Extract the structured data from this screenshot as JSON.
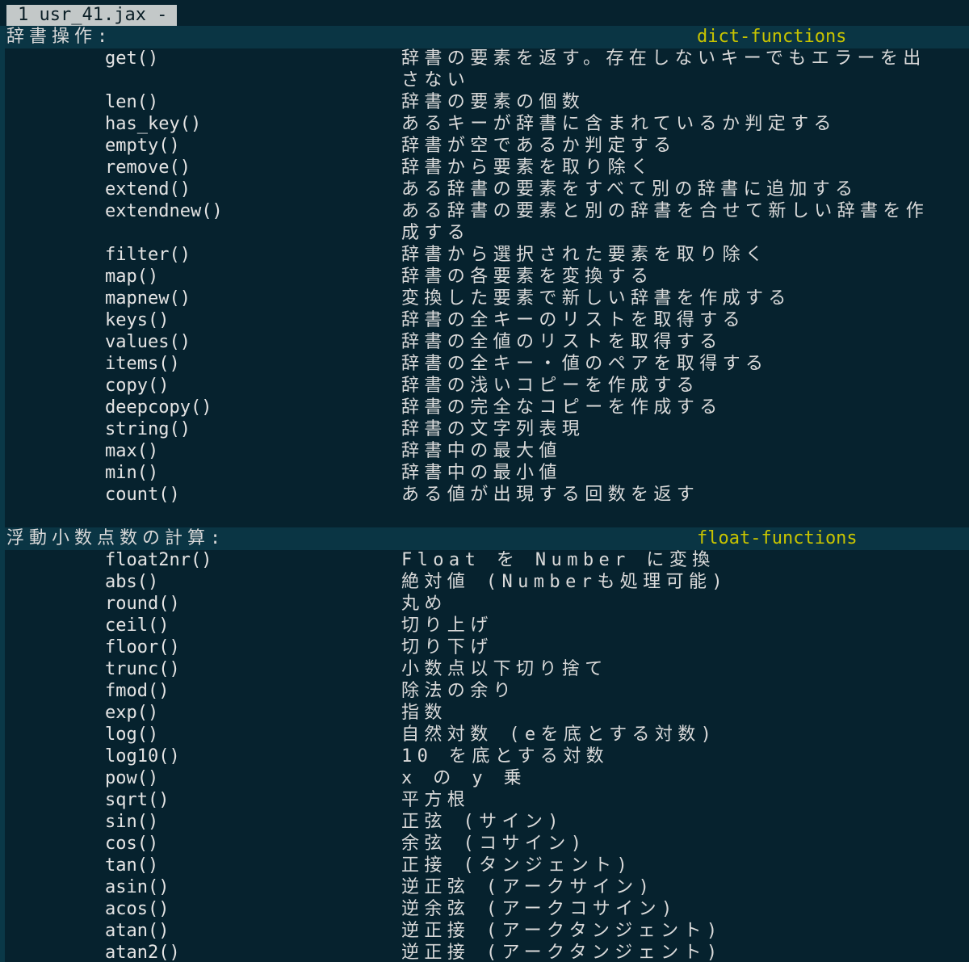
{
  "window": {
    "tab_label": "1 usr_41.jax -"
  },
  "sections": [
    {
      "title": "辞書操作:",
      "tag": "dict-functions",
      "entries": [
        {
          "fn": "get()",
          "desc": [
            "辞書の要素を返す。存在しないキーでもエラーを出",
            "さない"
          ]
        },
        {
          "fn": "len()",
          "desc": [
            "辞書の要素の個数"
          ]
        },
        {
          "fn": "has_key()",
          "desc": [
            "あるキーが辞書に含まれているか判定する"
          ]
        },
        {
          "fn": "empty()",
          "desc": [
            "辞書が空であるか判定する"
          ]
        },
        {
          "fn": "remove()",
          "desc": [
            "辞書から要素を取り除く"
          ]
        },
        {
          "fn": "extend()",
          "desc": [
            "ある辞書の要素をすべて別の辞書に追加する"
          ]
        },
        {
          "fn": "extendnew()",
          "desc": [
            "ある辞書の要素と別の辞書を合せて新しい辞書を作",
            "成する"
          ]
        },
        {
          "fn": "filter()",
          "desc": [
            "辞書から選択された要素を取り除く"
          ]
        },
        {
          "fn": "map()",
          "desc": [
            "辞書の各要素を変換する"
          ]
        },
        {
          "fn": "mapnew()",
          "desc": [
            "変換した要素で新しい辞書を作成する"
          ]
        },
        {
          "fn": "keys()",
          "desc": [
            "辞書の全キーのリストを取得する"
          ]
        },
        {
          "fn": "values()",
          "desc": [
            "辞書の全値のリストを取得する"
          ]
        },
        {
          "fn": "items()",
          "desc": [
            "辞書の全キー・値のペアを取得する"
          ]
        },
        {
          "fn": "copy()",
          "desc": [
            "辞書の浅いコピーを作成する"
          ]
        },
        {
          "fn": "deepcopy()",
          "desc": [
            "辞書の完全なコピーを作成する"
          ]
        },
        {
          "fn": "string()",
          "desc": [
            "辞書の文字列表現"
          ]
        },
        {
          "fn": "max()",
          "desc": [
            "辞書中の最大値"
          ]
        },
        {
          "fn": "min()",
          "desc": [
            "辞書中の最小値"
          ]
        },
        {
          "fn": "count()",
          "desc": [
            "ある値が出現する回数を返す"
          ]
        }
      ]
    },
    {
      "title": "浮動小数点数の計算:",
      "tag": "float-functions",
      "entries": [
        {
          "fn": "float2nr()",
          "desc": [
            "Float を Number に変換"
          ]
        },
        {
          "fn": "abs()",
          "desc": [
            "絶対値 (Numberも処理可能)"
          ]
        },
        {
          "fn": "round()",
          "desc": [
            "丸め"
          ]
        },
        {
          "fn": "ceil()",
          "desc": [
            "切り上げ"
          ]
        },
        {
          "fn": "floor()",
          "desc": [
            "切り下げ"
          ]
        },
        {
          "fn": "trunc()",
          "desc": [
            "小数点以下切り捨て"
          ]
        },
        {
          "fn": "fmod()",
          "desc": [
            "除法の余り"
          ]
        },
        {
          "fn": "exp()",
          "desc": [
            "指数"
          ]
        },
        {
          "fn": "log()",
          "desc": [
            "自然対数 (eを底とする対数)"
          ]
        },
        {
          "fn": "log10()",
          "desc": [
            "10 を底とする対数"
          ]
        },
        {
          "fn": "pow()",
          "desc": [
            "x の y 乗"
          ]
        },
        {
          "fn": "sqrt()",
          "desc": [
            "平方根"
          ]
        },
        {
          "fn": "sin()",
          "desc": [
            "正弦 (サイン)"
          ]
        },
        {
          "fn": "cos()",
          "desc": [
            "余弦 (コサイン)"
          ]
        },
        {
          "fn": "tan()",
          "desc": [
            "正接 (タンジェント)"
          ]
        },
        {
          "fn": "asin()",
          "desc": [
            "逆正弦 (アークサイン)"
          ]
        },
        {
          "fn": "acos()",
          "desc": [
            "逆余弦 (アークコサイン)"
          ]
        },
        {
          "fn": "atan()",
          "desc": [
            "逆正接 (アークタンジェント)"
          ]
        },
        {
          "fn": "atan2()",
          "desc": [
            "逆正接 (アークタンジェント)"
          ]
        }
      ]
    }
  ],
  "colors": {
    "background": "#06222e",
    "header_band": "#0a3544",
    "tag": "#c8c400",
    "tab_bg": "#c3c8c8"
  }
}
